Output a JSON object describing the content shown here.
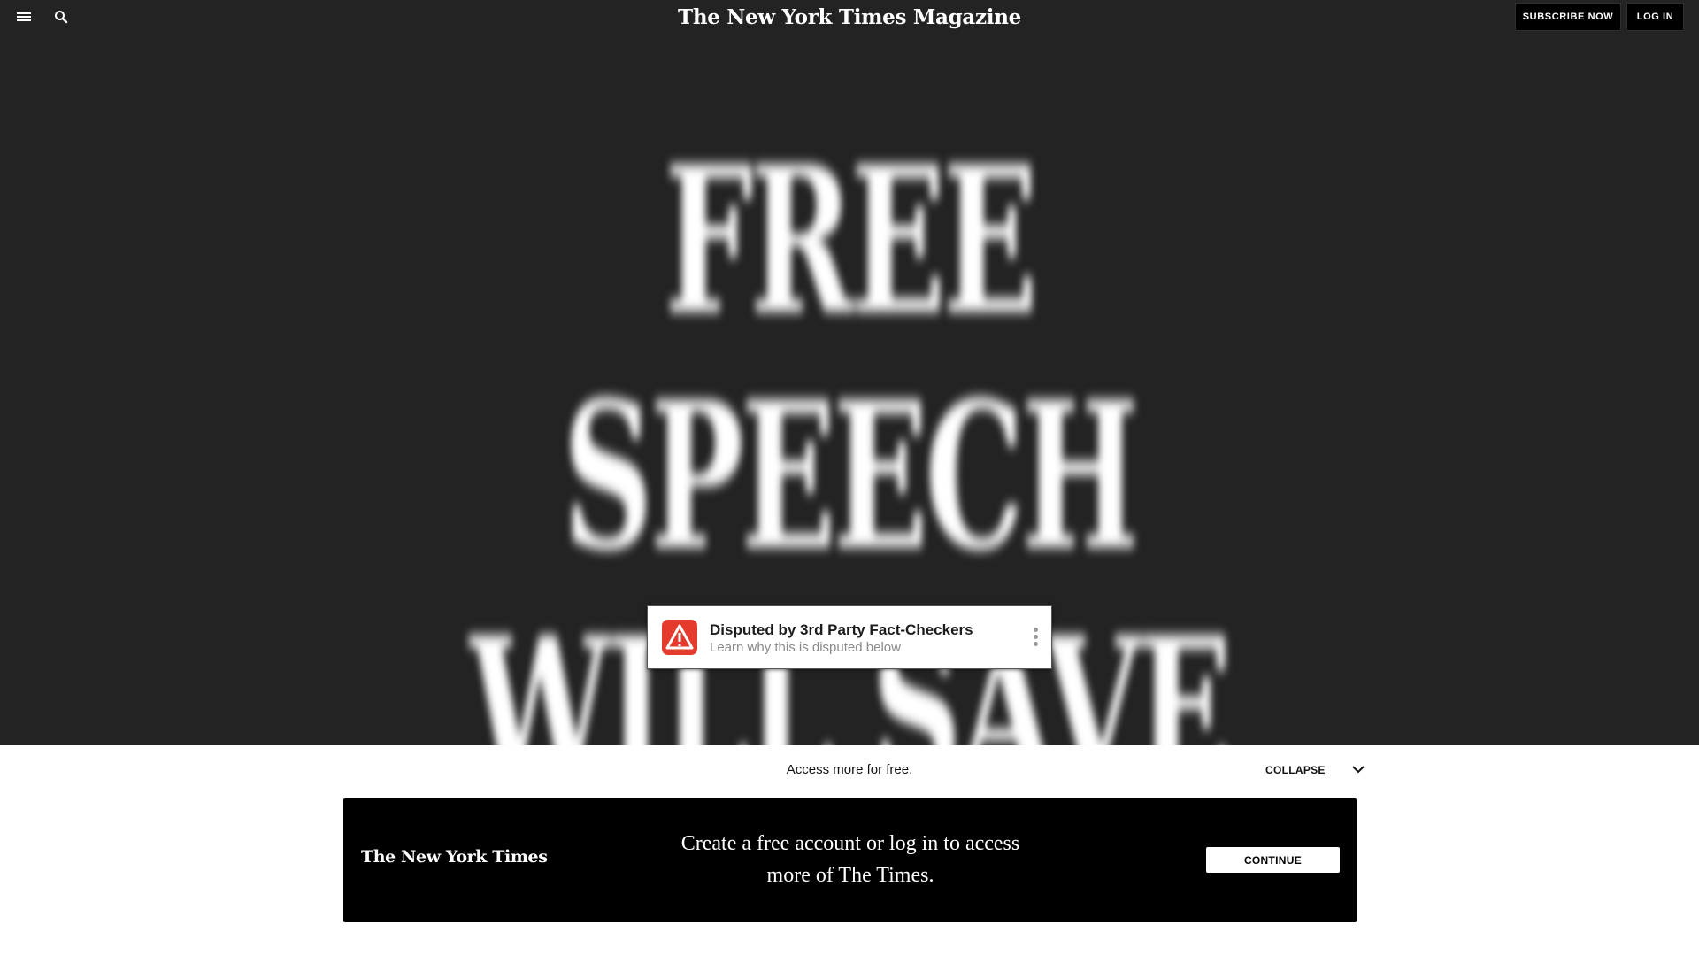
{
  "header": {
    "menu_icon": "hamburger-menu-icon",
    "search_icon": "search-icon",
    "masthead": "The New York Times Magazine",
    "subscribe_label": "SUBSCRIBE NOW",
    "login_label": "LOG IN"
  },
  "hero": {
    "lines": [
      "FREE",
      "SPEECH",
      "WILL SAVE"
    ]
  },
  "badge": {
    "icon": "warning-triangle-icon",
    "title": "Disputed by 3rd Party Fact-Checkers",
    "subtitle": "Learn why this is disputed below",
    "more_icon": "more-vertical-icon"
  },
  "bottom_bar": {
    "access_text": "Access more for free.",
    "collapse_label": "COLLAPSE",
    "collapse_icon": "chevron-down-icon"
  },
  "promo": {
    "logo": "The New York Times",
    "message": "Create a free account or log in to access more of The Times.",
    "continue_label": "CONTINUE"
  },
  "colors": {
    "background": "#232323",
    "warning_red": "#e53b2c",
    "promo_background": "#000000"
  }
}
